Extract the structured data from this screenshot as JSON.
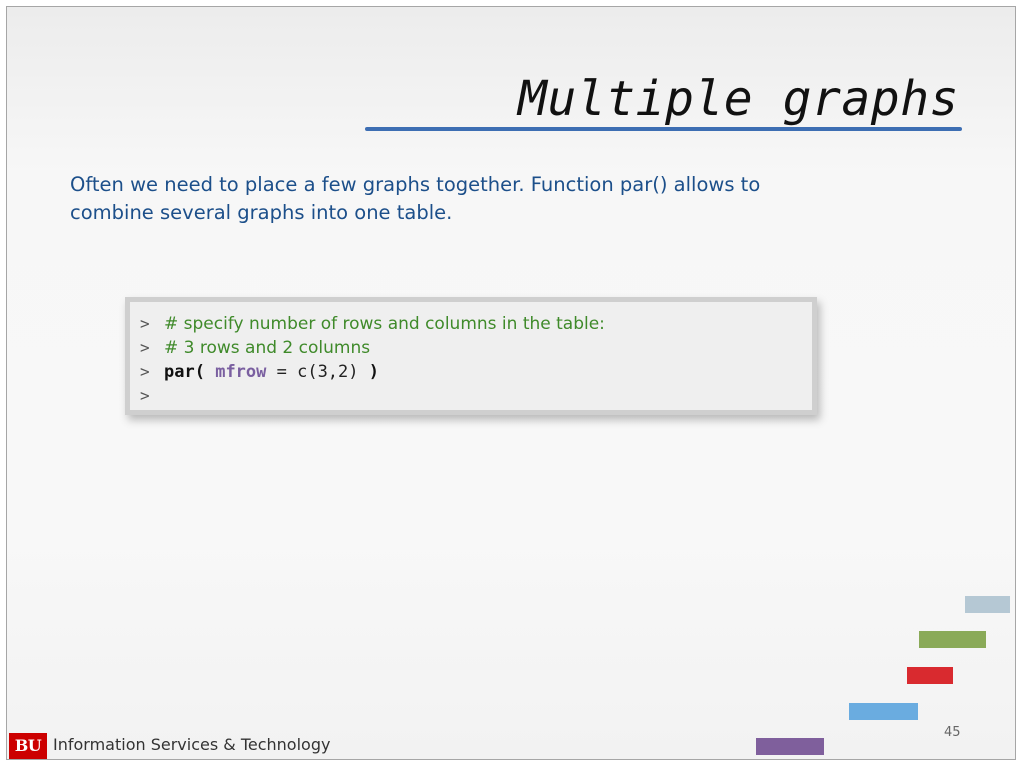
{
  "slide": {
    "title": "Multiple graphs",
    "intro": "Often we need to place a few graphs together. Function par() allows to combine several graphs into one table.",
    "code": {
      "prompt": ">",
      "comment_1": "# specify number of rows and columns in the table:",
      "comment_2": "# 3 rows and 2 columns",
      "fn": "par(",
      "arg": "mfrow",
      "rest": " = c(3,2) ",
      "close": ")"
    },
    "page_number": "45"
  },
  "footer": {
    "logo_text": "BU",
    "org_name": "Information Services & Technology"
  },
  "decor": {
    "bar_colors": [
      "#b5c8d4",
      "#8aaa58",
      "#d92a2f",
      "#6aace0",
      "#7f5f9c"
    ]
  }
}
